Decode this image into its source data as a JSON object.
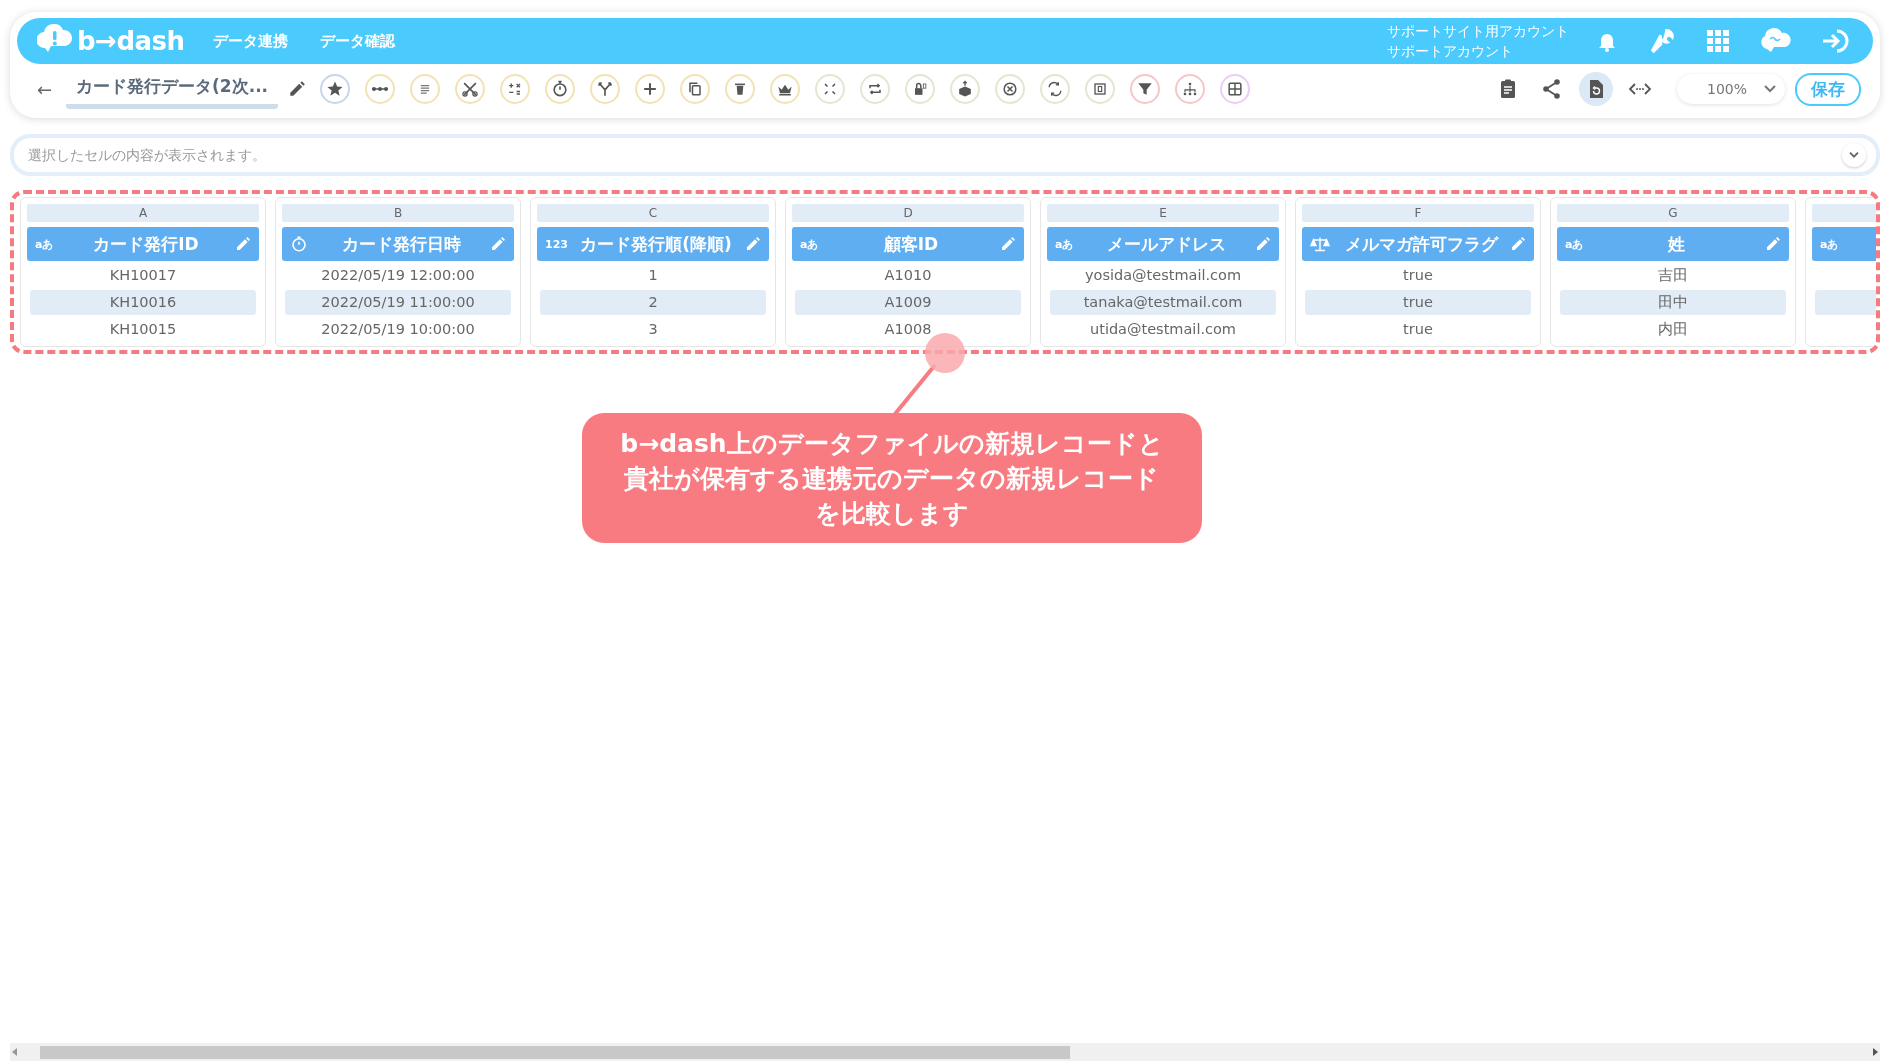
{
  "header": {
    "logo": "b→dash",
    "nav": [
      "データ連携",
      "データ確認"
    ],
    "account": [
      "サポートサイト用アカウント",
      "サポートアカウント"
    ]
  },
  "toolbar": {
    "back": "←",
    "title": "カード発行データ(2次...",
    "tools": [
      {
        "kind": "star",
        "color": "#c6d7eb"
      },
      {
        "kind": "dots-line",
        "color": "#f3e2b3"
      },
      {
        "kind": "lines",
        "color": "#f3e2b3"
      },
      {
        "kind": "scissors",
        "color": "#f3e2b3"
      },
      {
        "kind": "calculator",
        "color": "#f3e2b3"
      },
      {
        "kind": "stopwatch",
        "color": "#f3e2b3"
      },
      {
        "kind": "fork",
        "color": "#f3e2b3"
      },
      {
        "kind": "plus",
        "color": "#f3e2b3"
      },
      {
        "kind": "copy",
        "color": "#f3e2b3"
      },
      {
        "kind": "trash",
        "color": "#f3e2b3"
      },
      {
        "kind": "crown",
        "color": "#f3e2b3"
      },
      {
        "kind": "corners",
        "color": "#e2e7cf"
      },
      {
        "kind": "repeat",
        "color": "#e2e7cf"
      },
      {
        "kind": "lock",
        "color": "#e2e7cf"
      },
      {
        "kind": "box",
        "color": "#e2e7cf"
      },
      {
        "kind": "close-circle",
        "color": "#e2e7cf"
      },
      {
        "kind": "swap",
        "color": "#e2e7cf"
      },
      {
        "kind": "square",
        "color": "#e2e7cf"
      },
      {
        "kind": "funnel",
        "color": "#f7c6c6"
      },
      {
        "kind": "network",
        "color": "#f7c6c6"
      },
      {
        "kind": "grid",
        "color": "#eccdf4"
      }
    ],
    "right_tools": [
      {
        "kind": "clipboard",
        "selected": false
      },
      {
        "kind": "share",
        "selected": false
      },
      {
        "kind": "restore",
        "selected": true
      },
      {
        "kind": "code",
        "selected": false
      }
    ],
    "zoom": "100%",
    "save": "保存"
  },
  "formula_bar": {
    "placeholder": "選択したセルの内容が表示されます。"
  },
  "columns": [
    {
      "letter": "A",
      "kind": "text",
      "badge": "aあ",
      "name": "カード発行ID",
      "cells": [
        "KH10017",
        "KH10016",
        "KH10015"
      ]
    },
    {
      "letter": "B",
      "kind": "datetime",
      "name": "カード発行日時",
      "cells": [
        "2022/05/19 12:00:00",
        "2022/05/19 11:00:00",
        "2022/05/19 10:00:00"
      ]
    },
    {
      "letter": "C",
      "kind": "number",
      "badge": "123",
      "name": "カード発行順(降順)",
      "cells": [
        "1",
        "2",
        "3"
      ]
    },
    {
      "letter": "D",
      "kind": "text",
      "badge": "aあ",
      "name": "顧客ID",
      "cells": [
        "A1010",
        "A1009",
        "A1008"
      ]
    },
    {
      "letter": "E",
      "kind": "text",
      "badge": "aあ",
      "name": "メールアドレス",
      "cells": [
        "yosida@testmail.com",
        "tanaka@testmail.com",
        "utida@testmail.com"
      ]
    },
    {
      "letter": "F",
      "kind": "boolean",
      "name": "メルマガ許可フラグ",
      "cells": [
        "true",
        "true",
        "true"
      ]
    },
    {
      "letter": "G",
      "kind": "text",
      "badge": "aあ",
      "name": "姓",
      "cells": [
        "吉田",
        "田中",
        "内田"
      ]
    },
    {
      "kind": "text",
      "badge": "aあ"
    }
  ],
  "callout": {
    "lines": [
      "b→dash上のデータファイルの新規レコードと",
      "貴社が保有する連携元のデータの新規レコード",
      "を比較します"
    ]
  }
}
